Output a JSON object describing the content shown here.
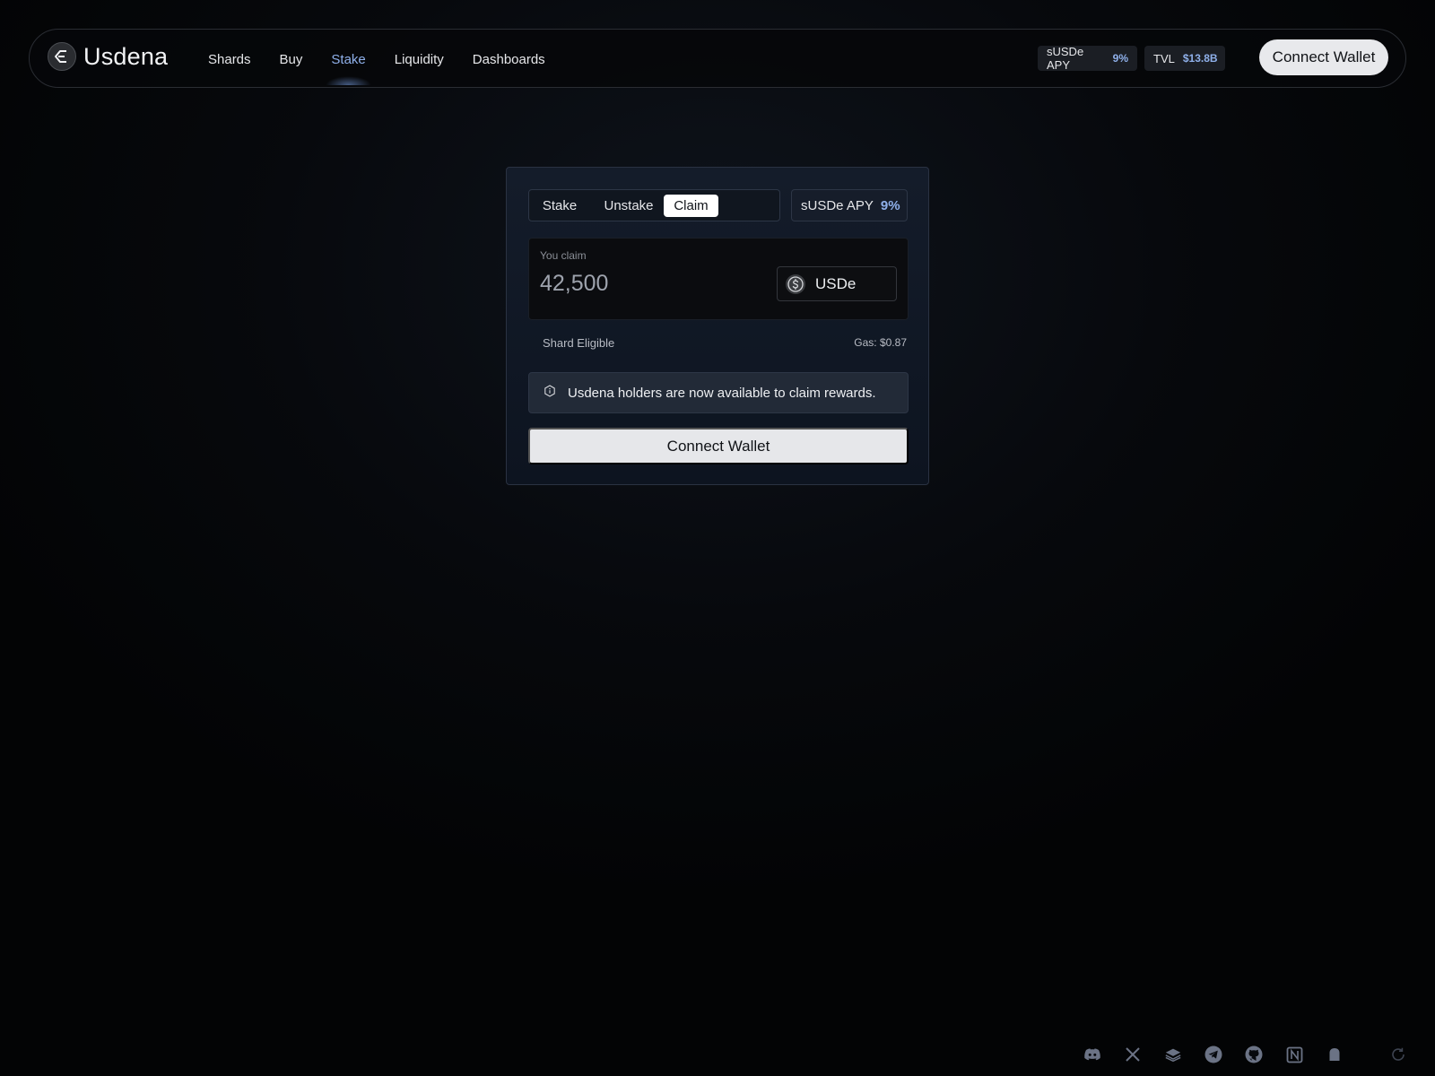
{
  "brand": {
    "name": "Usdena",
    "logo_icon": "usdena-logo-icon"
  },
  "nav": {
    "links": [
      {
        "label": "Shards",
        "active": false
      },
      {
        "label": "Buy",
        "active": false
      },
      {
        "label": "Stake",
        "active": true
      },
      {
        "label": "Liquidity",
        "active": false
      },
      {
        "label": "Dashboards",
        "active": false
      }
    ]
  },
  "header_stats": {
    "apy": {
      "label": "sUSDe APY",
      "value": "9%"
    },
    "tvl": {
      "label": "TVL",
      "value": "$13.8B"
    }
  },
  "header": {
    "connect_label": "Connect Wallet"
  },
  "card": {
    "tabs": [
      {
        "label": "Stake",
        "selected": false
      },
      {
        "label": "Unstake",
        "selected": false
      },
      {
        "label": "Claim",
        "selected": true
      }
    ],
    "apy": {
      "label": "sUSDe APY",
      "value": "9%"
    },
    "claim": {
      "label": "You claim",
      "amount": "42,500",
      "token": "USDe",
      "token_icon": "dollar-coin-icon"
    },
    "shard_text": "Shard Eligible",
    "gas_text": "Gas: $0.87",
    "notice": {
      "icon": "info-hexagon-icon",
      "text": "Usdena holders are now available to claim rewards."
    },
    "connect_label": "Connect Wallet"
  },
  "footer": {
    "social_icons": [
      "discord-icon",
      "x-icon",
      "layers-icon",
      "telegram-icon",
      "github-icon",
      "notion-icon",
      "ghost-icon"
    ],
    "refresh_icon": "refresh-icon"
  },
  "colors": {
    "accent": "#8fb0ea",
    "background": "#040507",
    "card": "#141c2a",
    "button": "#e6e7ea"
  }
}
